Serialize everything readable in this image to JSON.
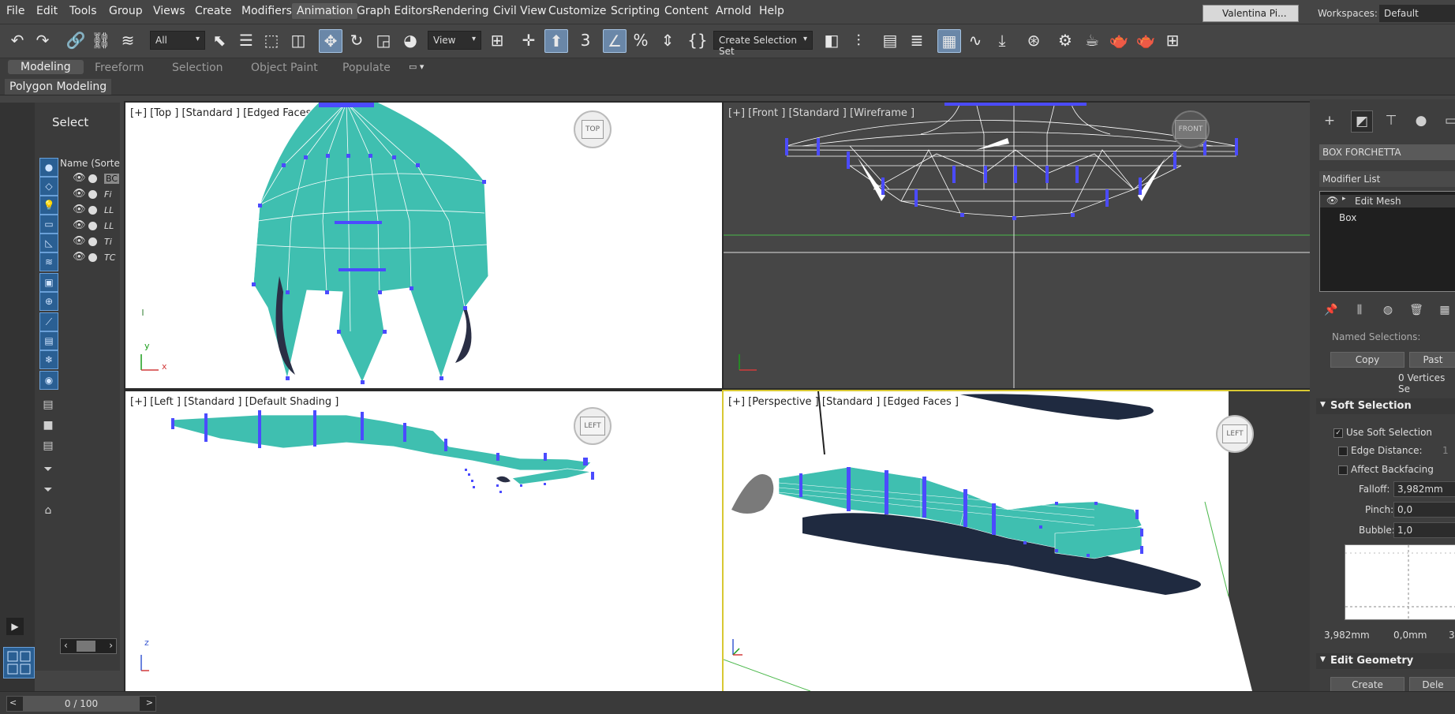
{
  "menu": [
    "File",
    "Edit",
    "Tools",
    "Group",
    "Views",
    "Create",
    "Modifiers",
    "Animation",
    "Graph Editors",
    "Rendering",
    "Civil View",
    "Customize",
    "Scripting",
    "Content",
    "Arnold",
    "Help"
  ],
  "user": "Valentina Pi...",
  "workspaces": {
    "label": "Workspaces:",
    "value": "Default"
  },
  "toolbar": {
    "filter": "All",
    "ref_coord": "View",
    "selection_set": "Create Selection Set"
  },
  "ribbon": {
    "tabs": [
      "Modeling",
      "Freeform",
      "Selection",
      "Object Paint",
      "Populate"
    ],
    "panel": "Polygon Modeling"
  },
  "scene_explorer": {
    "title": "Select",
    "column": "Name (Sorte",
    "rows": [
      "BC",
      "Fi",
      "LL",
      "LL",
      "Ti",
      "TC"
    ]
  },
  "viewports": {
    "top": "[+] [Top ] [Standard ] [Edged Faces ]",
    "front": "[+] [Front ] [Standard ] [Wireframe ]",
    "left": "[+] [Left ] [Standard ] [Default Shading ]",
    "perspective": "[+] [Perspective ] [Standard ] [Edged Faces ]"
  },
  "viewcube": {
    "top": "TOP",
    "front": "FRONT",
    "left": "LEFT",
    "persp": "LEFT"
  },
  "command_panel": {
    "object_name": "BOX FORCHETTA",
    "modifier_list": "Modifier List",
    "stack": [
      "Edit Mesh",
      "Box"
    ],
    "named_selections": "Named Selections:",
    "copy": "Copy",
    "paste": "Past",
    "vertices_info": "0 Vertices Se",
    "soft_selection": {
      "title": "Soft Selection",
      "use": "Use Soft Selection",
      "edge_distance": "Edge Distance:",
      "edge_distance_val": "1",
      "affect_backfacing": "Affect Backfacing",
      "falloff_label": "Falloff:",
      "falloff": "3,982mm",
      "pinch_label": "Pinch:",
      "pinch": "0,0",
      "bubble_label": "Bubble:",
      "bubble": "1,0",
      "curve_left": "3,982mm",
      "curve_mid": "0,0mm",
      "curve_right": "3"
    },
    "edit_geometry": {
      "title": "Edit Geometry",
      "create": "Create",
      "delete": "Dele"
    }
  },
  "time_slider": "0 / 100",
  "axis": {
    "x": "x",
    "y": "y",
    "z": "z"
  },
  "colors": {
    "mesh": "#3fbfb0",
    "vertex": "#4b4bff",
    "active_border": "#d8c832"
  }
}
